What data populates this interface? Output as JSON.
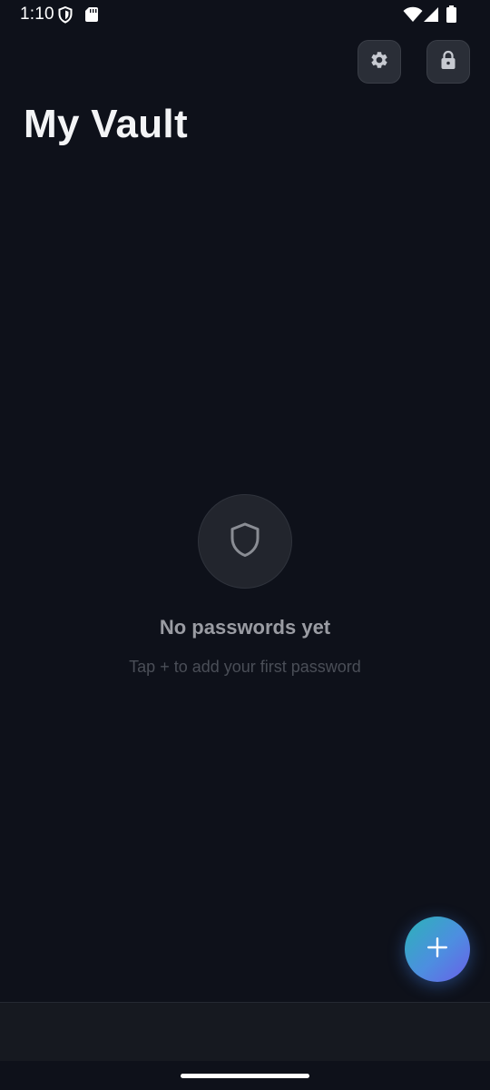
{
  "status_bar": {
    "time": "1:10",
    "icons": [
      "shield-status-icon",
      "sd-card-icon",
      "wifi-icon",
      "cellular-signal-icon",
      "battery-icon"
    ]
  },
  "header": {
    "title": "My Vault",
    "settings_icon": "gear-icon",
    "lock_icon": "lock-icon"
  },
  "empty_state": {
    "icon": "shield-icon",
    "title": "No passwords yet",
    "subtitle": "Tap + to add your first password"
  },
  "fab": {
    "icon": "plus-icon"
  },
  "colors": {
    "background": "#0e111a",
    "button_bg": "#2a2e37",
    "title": "#f3f4f6",
    "empty_title": "#9a9ca3",
    "empty_subtitle": "#4a4e57",
    "fab_gradient_start": "#2bb3b8",
    "fab_gradient_end": "#6a5fe8"
  }
}
